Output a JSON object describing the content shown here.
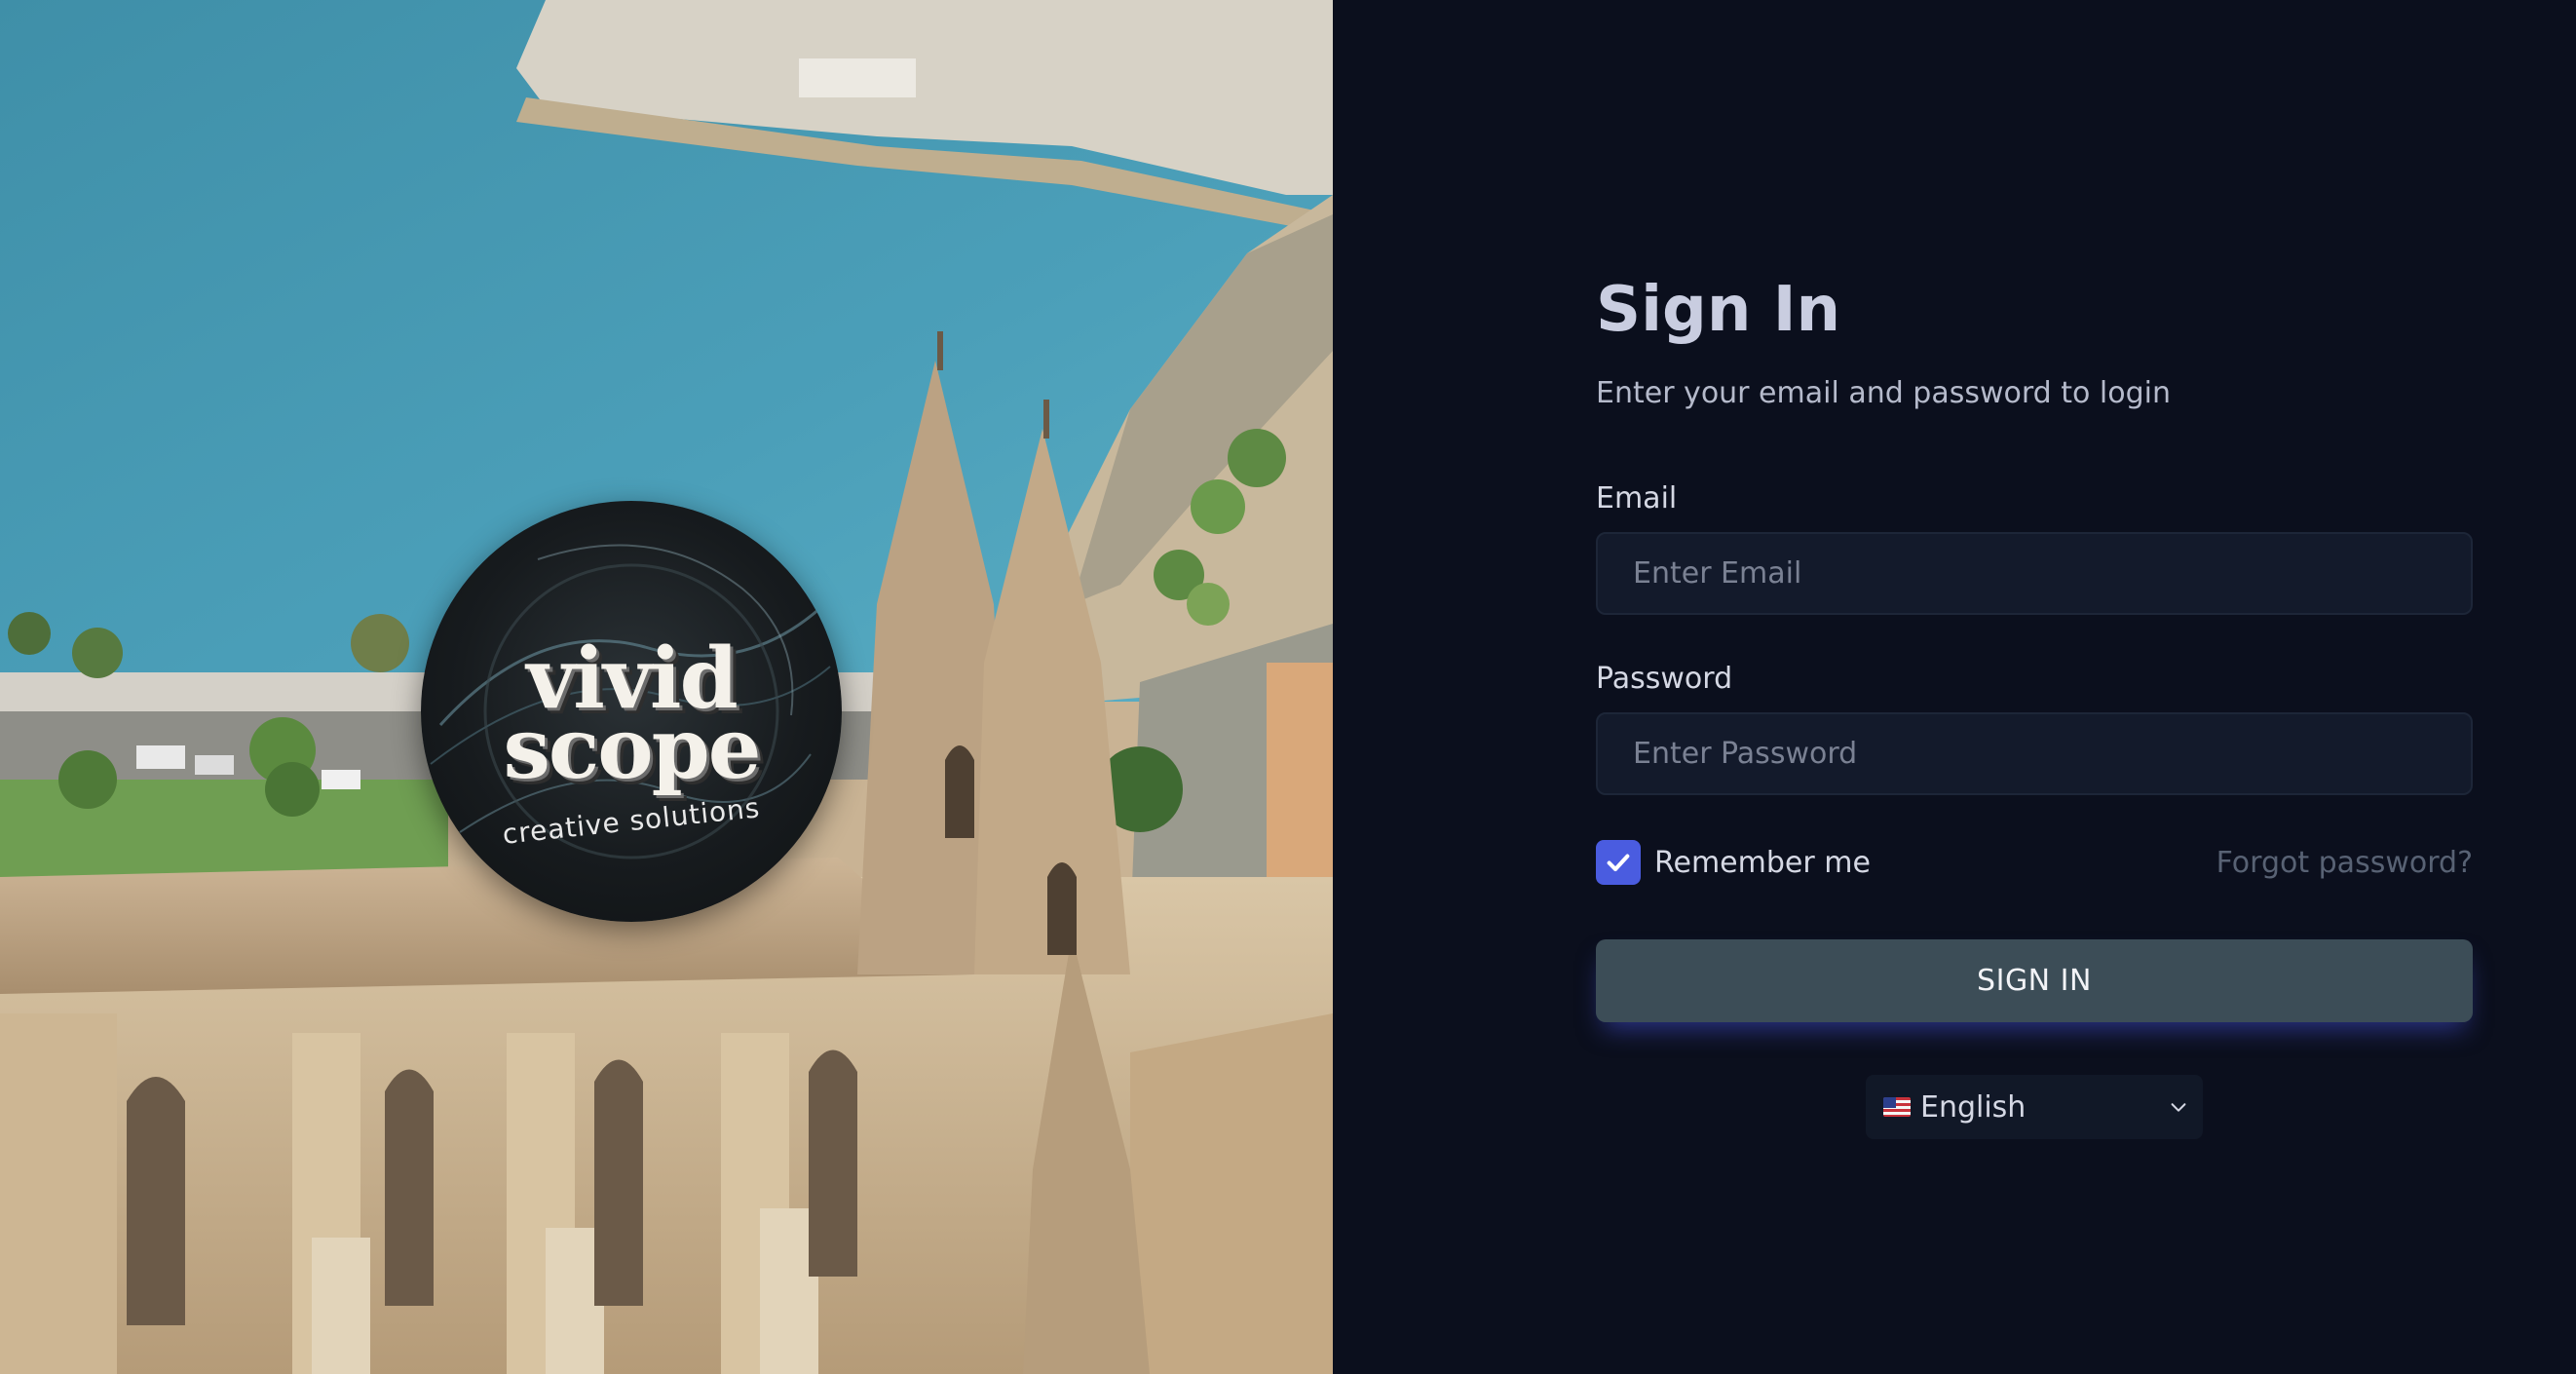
{
  "logo": {
    "word1": "vivid",
    "word2": "scope",
    "tagline": "creative solutions",
    "icon": "vividscope-logo-badge"
  },
  "form": {
    "title": "Sign In",
    "subtitle": "Enter your email and password to login",
    "email": {
      "label": "Email",
      "placeholder": "Enter Email",
      "value": ""
    },
    "password": {
      "label": "Password",
      "placeholder": "Enter Password",
      "value": ""
    },
    "remember": {
      "label": "Remember me",
      "checked": true,
      "icon": "checkmark-icon"
    },
    "forgot_label": "Forgot password?",
    "submit_label": "SIGN IN"
  },
  "language": {
    "selected": "English",
    "flag_icon": "us-flag-icon",
    "chevron_icon": "chevron-down-icon"
  },
  "colors": {
    "background": "#0b0f1d",
    "input_background": "#131a2b",
    "accent": "#4a5ce0",
    "button": "#3c4d57",
    "muted_link": "#586274"
  }
}
